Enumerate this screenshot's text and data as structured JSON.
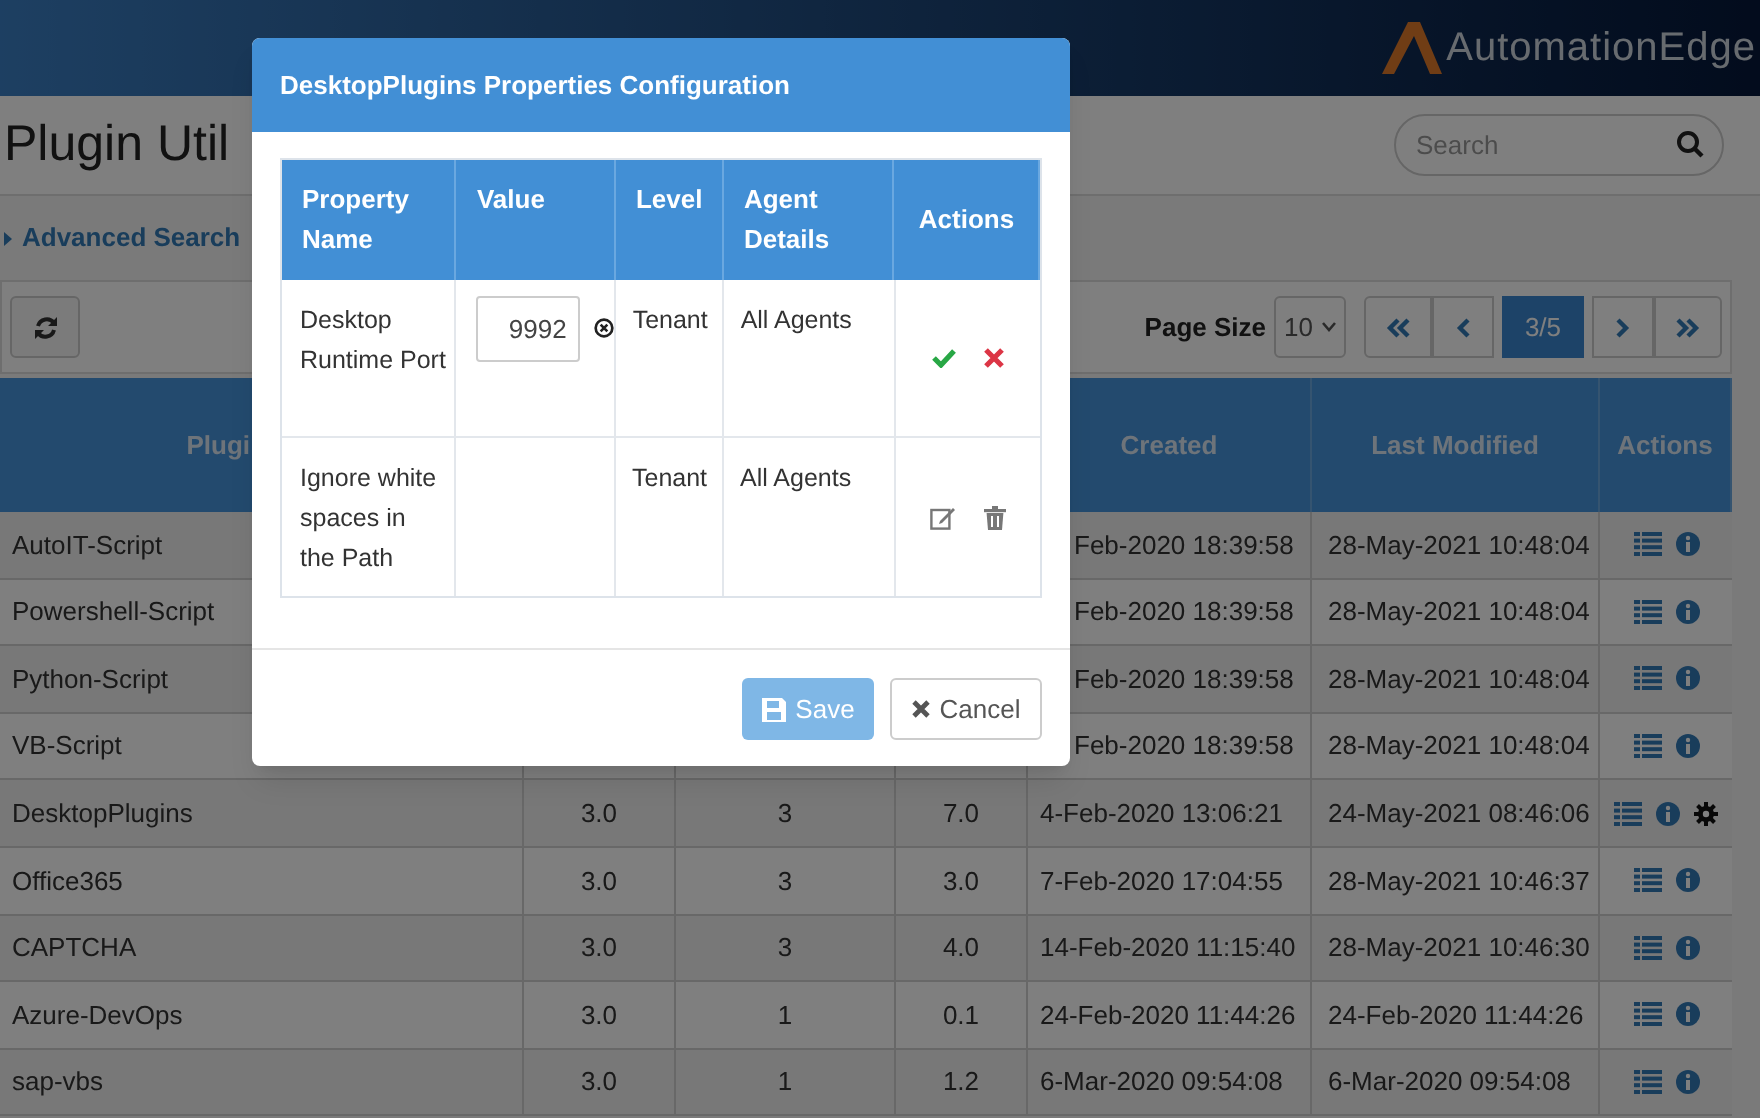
{
  "header": {
    "logo": "AutomationEdge"
  },
  "page": {
    "title": "Plugin Util",
    "search": {
      "placeholder": "Search"
    },
    "advanced_search": "Advanced Search"
  },
  "toolbar": {
    "page_size_label": "Page Size",
    "page_size": "10",
    "pager_current": "3/5"
  },
  "table": {
    "columns": [
      "Plugi",
      "Created",
      "Last Modified",
      "Actions"
    ],
    "rows": [
      {
        "name": "AutoIT-Script",
        "created": "Feb-2020 18:39:58",
        "modified": "28-May-2021 10:48:04",
        "actions": [
          {
            "kind": "list"
          },
          {
            "kind": "info"
          }
        ]
      },
      {
        "name": "Powershell-Script",
        "created": "Feb-2020 18:39:58",
        "modified": "28-May-2021 10:48:04",
        "actions": [
          {
            "kind": "list"
          },
          {
            "kind": "info"
          }
        ]
      },
      {
        "name": "Python-Script",
        "created": "Feb-2020 18:39:58",
        "modified": "28-May-2021 10:48:04",
        "actions": [
          {
            "kind": "list"
          },
          {
            "kind": "info"
          }
        ]
      },
      {
        "name": "VB-Script",
        "created": "Feb-2020 18:39:58",
        "modified": "28-May-2021 10:48:04",
        "actions": [
          {
            "kind": "list"
          },
          {
            "kind": "info"
          }
        ]
      },
      {
        "name": "DesktopPlugins",
        "column_2": "3.0",
        "column_3": "3",
        "column_4": "7.0",
        "created": "4-Feb-2020 13:06:21",
        "modified": "24-May-2021 08:46:06",
        "actions": [
          {
            "kind": "list"
          },
          {
            "kind": "info"
          },
          {
            "kind": "gear"
          }
        ]
      },
      {
        "name": "Office365",
        "column_2": "3.0",
        "column_3": "3",
        "column_4": "3.0",
        "created": "7-Feb-2020 17:04:55",
        "modified": "28-May-2021 10:46:37",
        "actions": [
          {
            "kind": "list"
          },
          {
            "kind": "info"
          }
        ]
      },
      {
        "name": "CAPTCHA",
        "column_2": "3.0",
        "column_3": "3",
        "column_4": "4.0",
        "created": "14-Feb-2020 11:15:40",
        "modified": "28-May-2021 10:46:30",
        "actions": [
          {
            "kind": "list"
          },
          {
            "kind": "info"
          }
        ]
      },
      {
        "name": "Azure-DevOps",
        "column_2": "3.0",
        "column_3": "1",
        "column_4": "0.1",
        "created": "24-Feb-2020 11:44:26",
        "modified": "24-Feb-2020 11:44:26",
        "actions": [
          {
            "kind": "list"
          },
          {
            "kind": "info"
          }
        ]
      },
      {
        "name": "sap-vbs",
        "column_2": "3.0",
        "column_3": "1",
        "column_4": "1.2",
        "created": "6-Mar-2020 09:54:08",
        "modified": "6-Mar-2020 09:54:08",
        "actions": [
          {
            "kind": "list"
          },
          {
            "kind": "info"
          }
        ]
      }
    ]
  },
  "dialog": {
    "title": "DesktopPlugins Properties Configuration",
    "columns": [
      "Property Name",
      "Value",
      "Level",
      "Agent Details",
      "Actions"
    ],
    "rows": [
      {
        "kind": "editing",
        "name": "Desktop Runtime Port",
        "value": "9992",
        "level": "Tenant",
        "agents": "All Agents"
      },
      {
        "kind": "view",
        "name": "Ignore white spaces in the Path",
        "level": "Tenant",
        "agents": "All Agents"
      }
    ],
    "buttons": [
      {
        "kind": "save",
        "label": "Save",
        "disabled": true
      },
      {
        "kind": "cancel",
        "label": "Cancel",
        "disabled": false
      }
    ]
  }
}
